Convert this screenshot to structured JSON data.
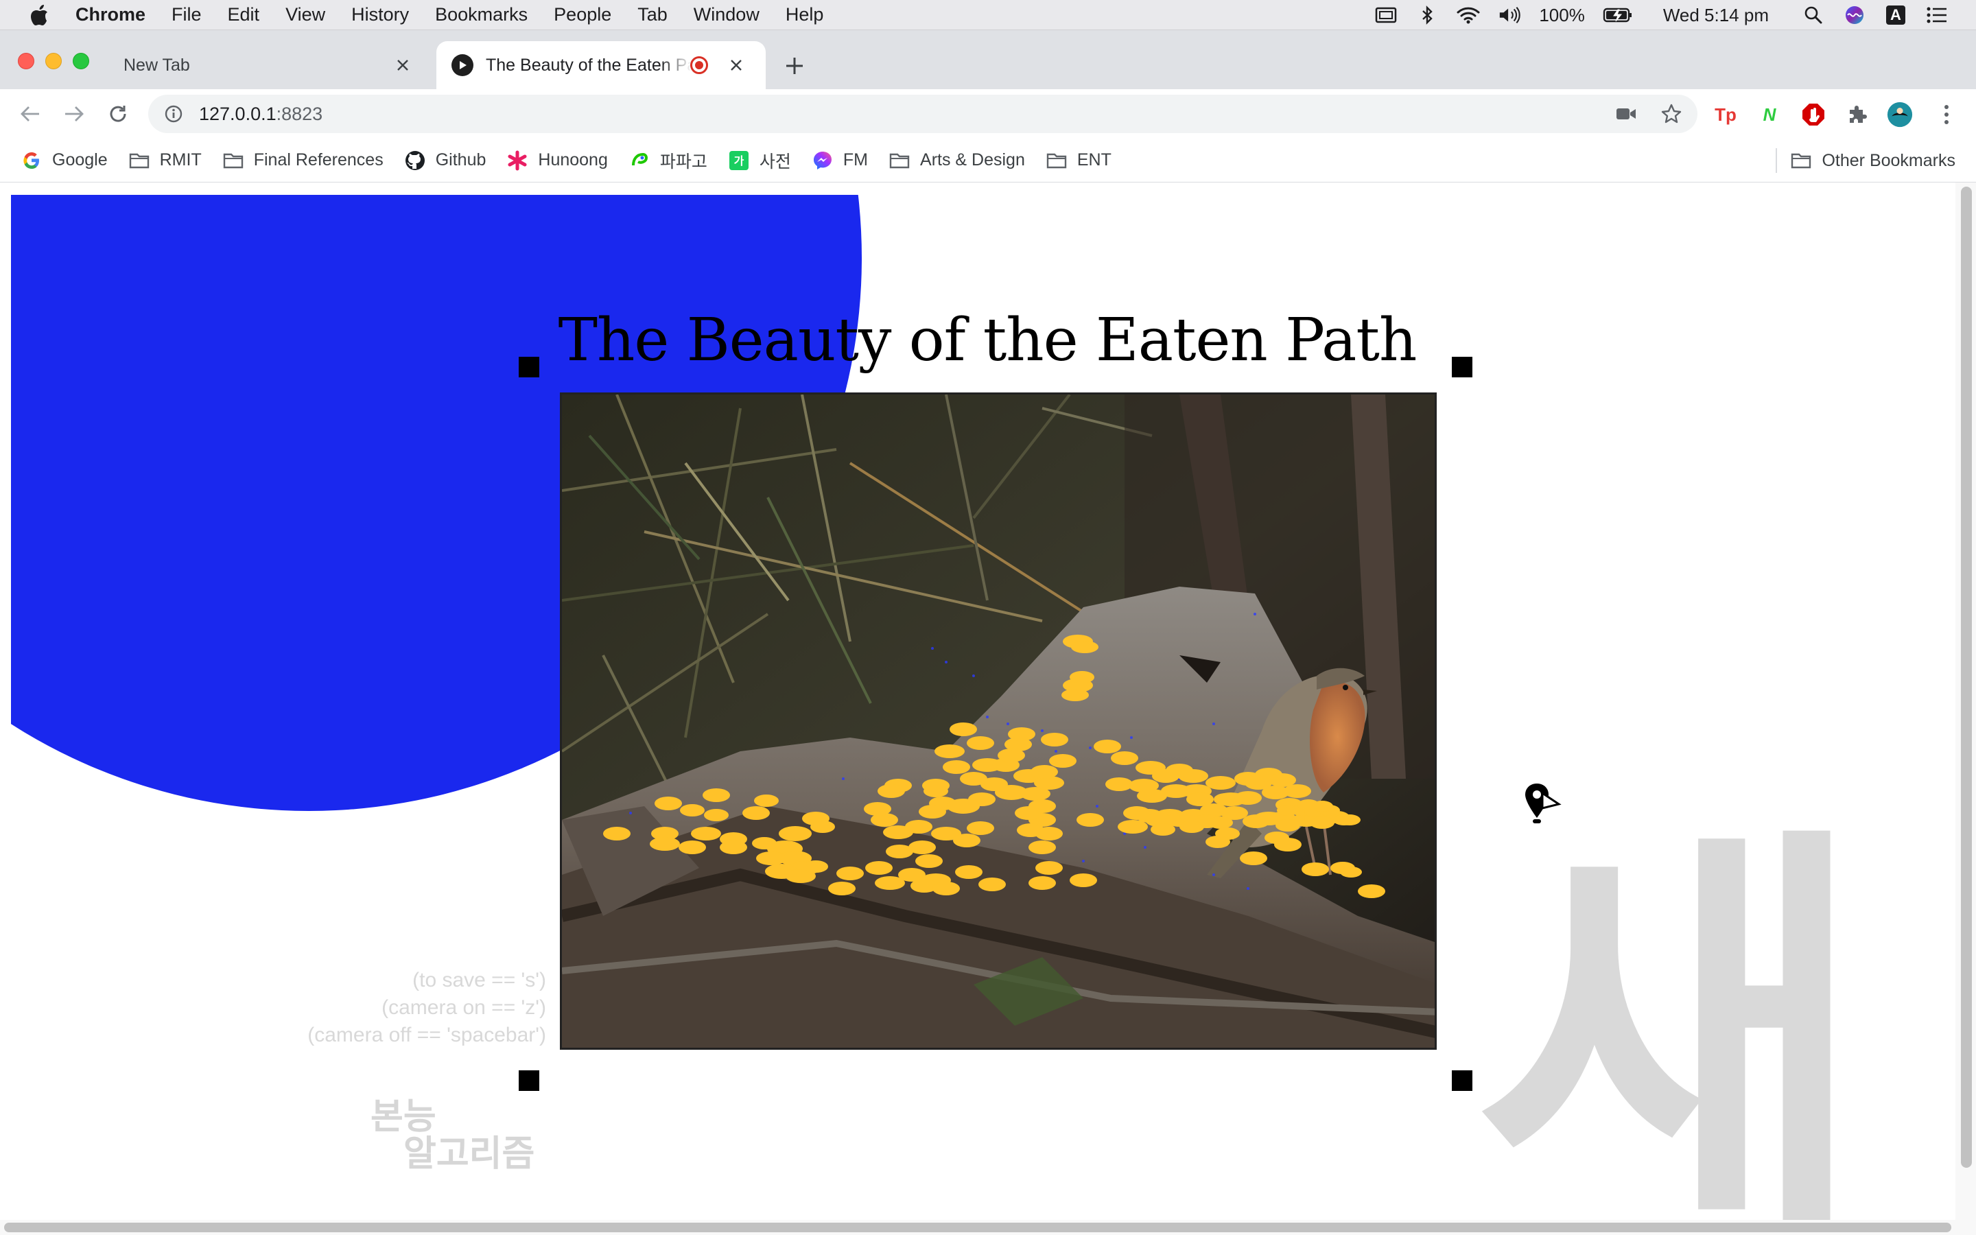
{
  "menubar": {
    "app_name": "Chrome",
    "items": [
      "File",
      "Edit",
      "View",
      "History",
      "Bookmarks",
      "People",
      "Tab",
      "Window",
      "Help"
    ],
    "battery": "100%",
    "clock": "Wed 5:14 pm",
    "icons": [
      "apple-icon",
      "screen-mirror-icon",
      "bluetooth-icon",
      "wifi-icon",
      "volume-icon",
      "battery-icon",
      "spotlight-icon",
      "siri-icon",
      "input-source-icon",
      "notification-center-icon"
    ],
    "input_source_letter": "A"
  },
  "tabs": [
    {
      "title": "New Tab",
      "active": false
    },
    {
      "title": "The Beauty of the Eaten Path",
      "active": true,
      "recording": true
    }
  ],
  "toolbar": {
    "url_host": "127.0.0.1",
    "url_port": ":8823",
    "extensions": [
      {
        "name": "tp-extension-icon",
        "label": "Tp",
        "color": "#e53935"
      },
      {
        "name": "n-extension-icon",
        "label": "N",
        "color": "#2ecc40"
      },
      {
        "name": "adblock-icon",
        "label": "",
        "color": "#d50000"
      },
      {
        "name": "extensions-puzzle-icon",
        "label": "",
        "color": "#5f6368"
      }
    ]
  },
  "bookmarks": {
    "items": [
      {
        "label": "Google",
        "icon": "google-icon"
      },
      {
        "label": "RMIT",
        "icon": "folder-icon"
      },
      {
        "label": "Final References",
        "icon": "folder-icon"
      },
      {
        "label": "Github",
        "icon": "github-icon"
      },
      {
        "label": "Hunoong",
        "icon": "asterisk-icon"
      },
      {
        "label": "파파고",
        "icon": "papago-icon"
      },
      {
        "label": "사전",
        "icon": "naver-dictionary-icon"
      },
      {
        "label": "FM",
        "icon": "messenger-icon"
      },
      {
        "label": "Arts & Design",
        "icon": "folder-icon"
      },
      {
        "label": "ENT",
        "icon": "folder-icon"
      }
    ],
    "other": "Other Bookmarks"
  },
  "page": {
    "title": "The Beauty of the Eaten Path",
    "hints": [
      "(to save == 's')",
      "(camera on == 'z')",
      "(camera off == 'spacebar')"
    ],
    "korean_small": [
      "본능",
      "알고리즘"
    ],
    "korean_big": "새",
    "colors": {
      "blue": "#1a28ee",
      "dots": "#ffc229",
      "gray_text": "#d8d8d8"
    }
  }
}
